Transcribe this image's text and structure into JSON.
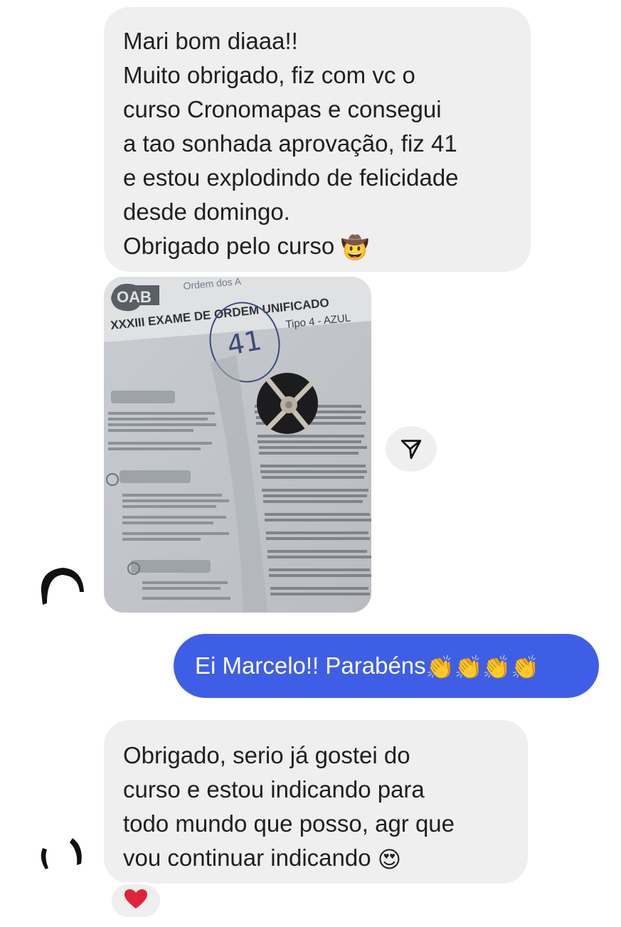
{
  "messages": {
    "msg1": {
      "lines": [
        "Mari bom diaaa!!",
        "Muito obrigado, fiz com vc o",
        "curso Cronomapas e consegui",
        "a tao sonhada aprovação, fiz 41",
        "e estou explodindo de felicidade",
        "desde domingo.",
        "Obrigado pelo curso"
      ],
      "emoji": "🤠"
    },
    "photo": {
      "logo_text": "OAB",
      "header_top": "Ordem dos A",
      "exam_title": "XXXIII EXAME DE ORDEM UNIFICADO",
      "type_label": "Tipo 4 - AZUL",
      "score_circled": "41"
    },
    "msg2": {
      "text": "Ei Marcelo!! Parabéns",
      "emoji": "👏👏👏👏"
    },
    "msg3": {
      "lines": [
        "Obrigado, serio já gostei do",
        "curso e estou indicando para",
        "todo mundo que posso, agr que",
        "vou continuar indicando"
      ],
      "emoji": "😍"
    }
  },
  "reaction": {
    "emoji": "❤️"
  },
  "icons": {
    "share": "paper-plane-icon",
    "avatar": "profile-avatar"
  },
  "colors": {
    "incoming_bubble": "#efefef",
    "outgoing_bubble": "#3f5ee6",
    "outgoing_text": "#ffffff"
  }
}
